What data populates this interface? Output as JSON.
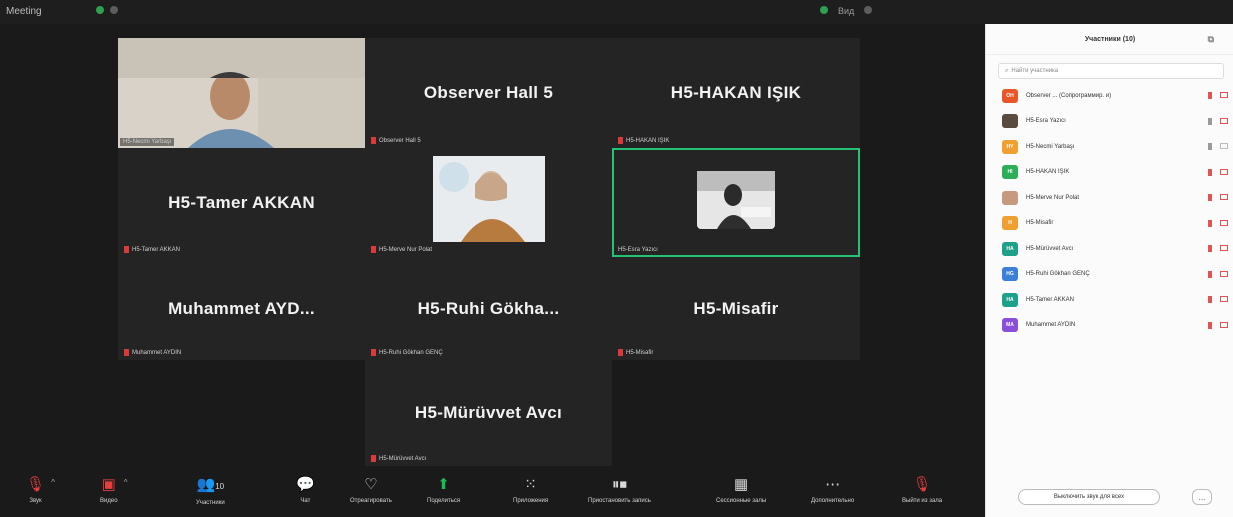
{
  "titlebar": {
    "title": "Meeting",
    "right_text": "Вид"
  },
  "tiles": [
    {
      "id": "t1",
      "big_name": "",
      "tag": "H5-Necmi Yarbaşı",
      "has_video": true,
      "muted": false
    },
    {
      "id": "t2",
      "big_name": "Observer Hall 5",
      "tag": "Observer Hall 5",
      "has_video": false,
      "muted": true
    },
    {
      "id": "t3",
      "big_name": "H5-HAKAN IŞIK",
      "tag": "H5-HAKAN IŞIK",
      "has_video": false,
      "muted": true
    },
    {
      "id": "t4",
      "big_name": "H5-Tamer AKKAN",
      "tag": "H5-Tamer AKKAN",
      "has_video": false,
      "muted": true
    },
    {
      "id": "t5",
      "big_name": "",
      "tag": "H5-Merve Nur Polat",
      "has_video": true,
      "muted": true
    },
    {
      "id": "t6",
      "big_name": "",
      "tag": "H5-Esra Yazıcı",
      "has_video": true,
      "muted": false,
      "active": true
    },
    {
      "id": "t7",
      "big_name": "Muhammet AYD...",
      "tag": "Muhammet AYDIN",
      "has_video": false,
      "muted": true
    },
    {
      "id": "t8",
      "big_name": "H5-Ruhi Gökha...",
      "tag": "H5-Ruhi Gökhan GENÇ",
      "has_video": false,
      "muted": true
    },
    {
      "id": "t9",
      "big_name": "H5-Misafir",
      "tag": "H5-Misafir",
      "has_video": false,
      "muted": true
    },
    {
      "id": "t10",
      "big_name": "H5-Mürüvvet Avcı",
      "tag": "H5-Mürüvvet Avcı",
      "has_video": false,
      "muted": true
    }
  ],
  "toolbar": {
    "mute_label": "Звук",
    "video_label": "Видео",
    "participants_label": "Участники",
    "participants_count": "10",
    "chat_label": "Чат",
    "react_label": "Отреагировать",
    "share_label": "Поделиться",
    "apps_label": "Приложения",
    "record_label": "Приостановить запись",
    "breakout_label": "Сессионные залы",
    "more_label": "Дополнительно",
    "leave_label": "Выйти из зала"
  },
  "panel": {
    "title": "Участники (10)",
    "search_placeholder": "Найти участника",
    "participants": [
      {
        "initials": "OH",
        "name": "Observer ... (Сопрограммир. и)",
        "color": "#e8572a",
        "mic_on": false,
        "cam_on": false
      },
      {
        "initials": "",
        "name": "H5-Esra Yazıcı",
        "color": "#5a4b3f",
        "mic_on": true,
        "cam_on": false
      },
      {
        "initials": "HY",
        "name": "H5-Necmi Yarbaşı",
        "color": "#f0a030",
        "mic_on": true,
        "cam_on": true
      },
      {
        "initials": "HI",
        "name": "H5-HAKAN IŞIK",
        "color": "#2eae5a",
        "mic_on": false,
        "cam_on": false
      },
      {
        "initials": "",
        "name": "H5-Merve Nur Polat",
        "color": "#c79a80",
        "mic_on": false,
        "cam_on": false
      },
      {
        "initials": "H",
        "name": "H5-Misafir",
        "color": "#f0a030",
        "mic_on": false,
        "cam_on": false
      },
      {
        "initials": "HA",
        "name": "H5-Mürüvvet Avcı",
        "color": "#1ea08a",
        "mic_on": false,
        "cam_on": false
      },
      {
        "initials": "HG",
        "name": "H5-Ruhi Gökhan GENÇ",
        "color": "#3b7fd6",
        "mic_on": false,
        "cam_on": false
      },
      {
        "initials": "HA",
        "name": "H5-Tamer AKKAN",
        "color": "#1ea08a",
        "mic_on": false,
        "cam_on": false
      },
      {
        "initials": "MA",
        "name": "Muhammet AYDIN",
        "color": "#8a4fd8",
        "mic_on": false,
        "cam_on": false
      }
    ],
    "mute_all_label": "Выключить звук для всех",
    "more_label": "..."
  }
}
